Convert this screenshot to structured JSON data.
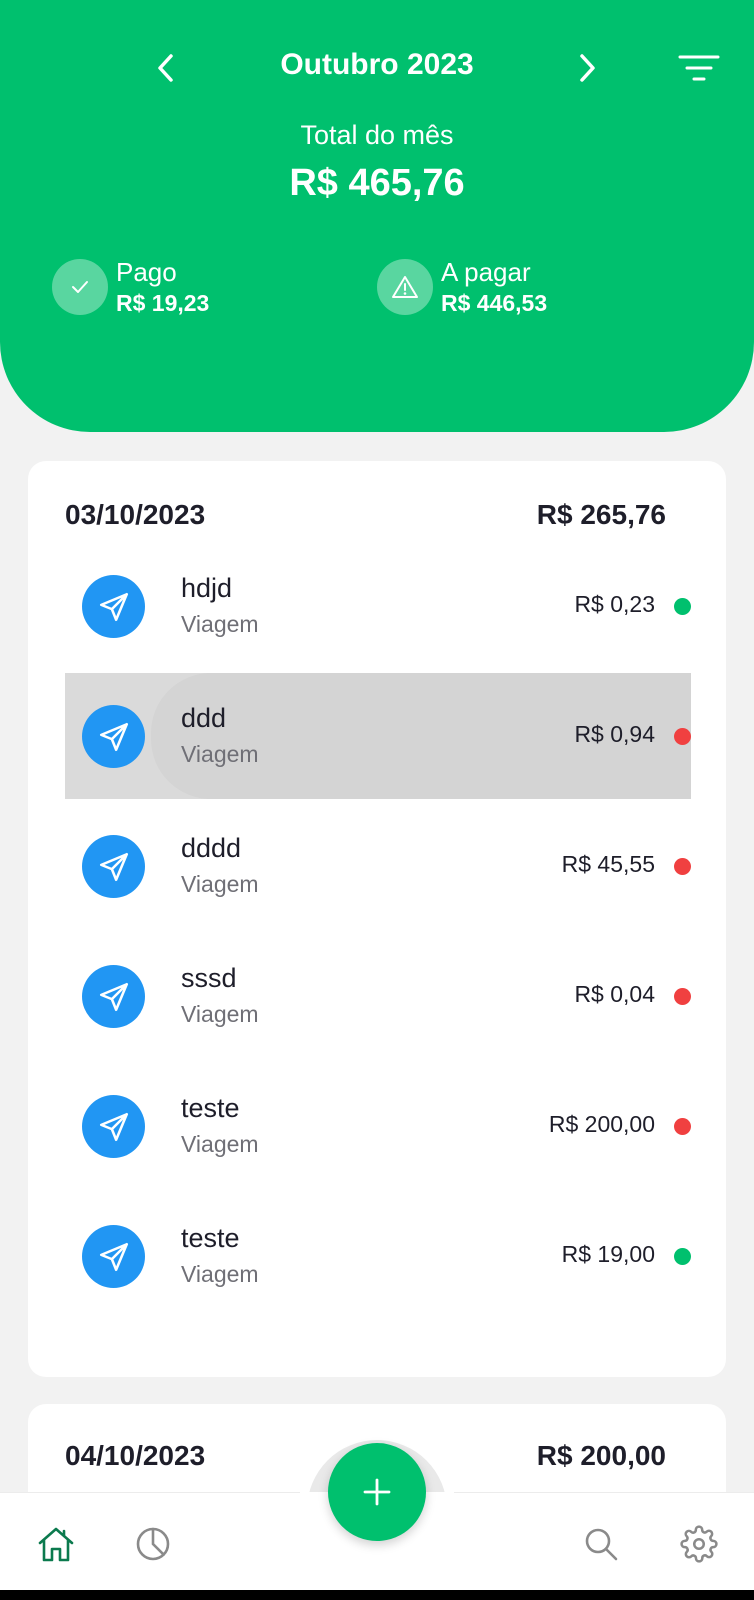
{
  "header": {
    "month": "Outubro 2023",
    "total_label": "Total do mês",
    "total_value": "R$ 465,76",
    "paid_label": "Pago",
    "paid_value": "R$ 19,23",
    "due_label": "A pagar",
    "due_value": "R$ 446,53"
  },
  "colors": {
    "brand_green": "#00c06e",
    "icon_blue": "#2196f3",
    "paid_dot": "#00c06e",
    "unpaid_dot": "#f04040"
  },
  "groups": [
    {
      "date": "03/10/2023",
      "total": "R$ 265,76",
      "items": [
        {
          "name": "hdjd",
          "category": "Viagem",
          "amount": "R$ 0,23",
          "status": "paid",
          "icon": "send-icon"
        },
        {
          "name": "ddd",
          "category": "Viagem",
          "amount": "R$ 0,94",
          "status": "unpaid",
          "icon": "send-icon"
        },
        {
          "name": "dddd",
          "category": "Viagem",
          "amount": "R$ 45,55",
          "status": "unpaid",
          "icon": "send-icon"
        },
        {
          "name": "sssd",
          "category": "Viagem",
          "amount": "R$ 0,04",
          "status": "unpaid",
          "icon": "send-icon"
        },
        {
          "name": "teste",
          "category": "Viagem",
          "amount": "R$ 200,00",
          "status": "unpaid",
          "icon": "send-icon"
        },
        {
          "name": "teste",
          "category": "Viagem",
          "amount": "R$ 19,00",
          "status": "paid",
          "icon": "send-icon"
        }
      ]
    },
    {
      "date": "04/10/2023",
      "total": "R$ 200,00",
      "items": []
    }
  ],
  "bottom_nav": {
    "tabs": [
      "home-icon",
      "chart-pie-icon",
      "search-icon",
      "settings-icon"
    ],
    "fab_icon": "plus-icon"
  }
}
